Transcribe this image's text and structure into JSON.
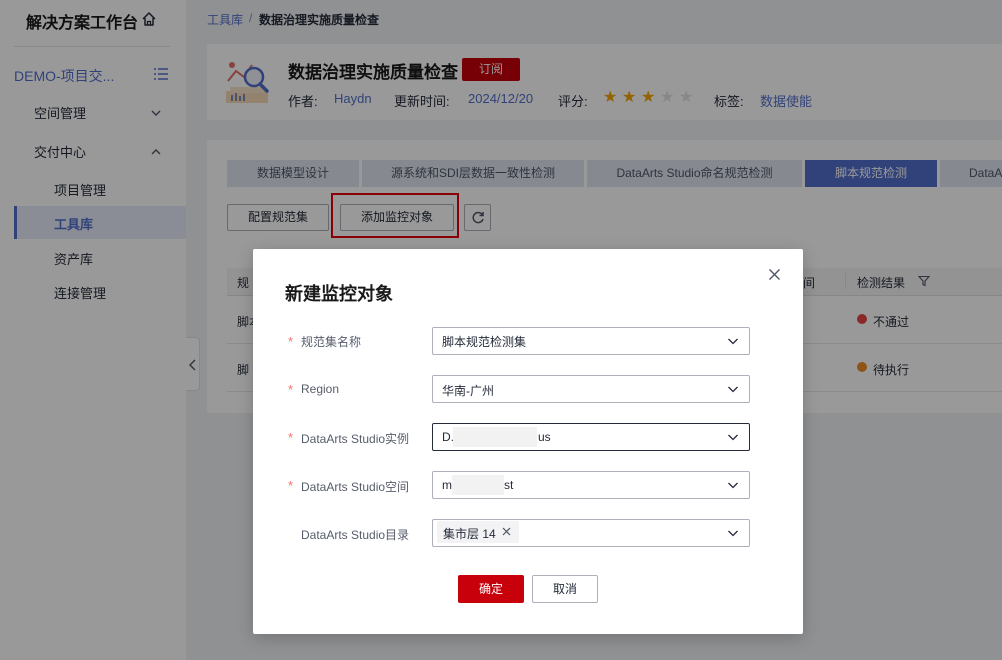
{
  "sidebar": {
    "brand_title": "解决方案工作台",
    "project_title": "DEMO-项目交...",
    "nav": [
      {
        "label": "空间管理"
      },
      {
        "label": "交付中心"
      }
    ],
    "sub_items": [
      {
        "label": "项目管理"
      },
      {
        "label": "工具库"
      },
      {
        "label": "资产库"
      },
      {
        "label": "连接管理"
      }
    ]
  },
  "breadcrumb": {
    "link": "工具库",
    "separator": "/",
    "current": "数据治理实施质量检查"
  },
  "header": {
    "title": "数据治理实施质量检查",
    "subscribe_label": "订阅",
    "author_label": "作者:",
    "author": "Haydn",
    "updated_label": "更新时间:",
    "updated": "2024/12/20",
    "rating_label": "评分:",
    "rating": 3,
    "rating_max": 5,
    "tags_label": "标签:",
    "tag": "数据使能",
    "star_glyph": "★"
  },
  "tabs": [
    {
      "label": "数据模型设计"
    },
    {
      "label": "源系统和SDI层数据一致性检测"
    },
    {
      "label": "DataArts Studio命名规范检测"
    },
    {
      "label": "脚本规范检测"
    },
    {
      "label": "DataA"
    }
  ],
  "toolbar": {
    "config_label": "配置规范集",
    "add_label": "添加监控对象"
  },
  "table": {
    "col_partial": "规",
    "col_time_partial": "间",
    "col_result": "检测结果",
    "rows": [
      {
        "name_partial": "脚本",
        "status": "不通过",
        "status_color": "#e54545"
      },
      {
        "name_partial": "脚",
        "status": "待执行",
        "status_color": "#ec8c24"
      }
    ]
  },
  "modal": {
    "title": "新建监控对象",
    "required_mark": "*",
    "fields": [
      {
        "label": "规范集名称",
        "value": "脚本规范检测集",
        "required": true
      },
      {
        "label": "Region",
        "value": "华南-广州",
        "required": true
      },
      {
        "label": "DataArts Studio实例",
        "value_start": "D.",
        "value_end": "us",
        "required": true
      },
      {
        "label": "DataArts Studio空间",
        "value_start": "m",
        "value_end": "st",
        "required": true
      },
      {
        "label": "DataArts Studio目录",
        "tag": "集市层 14",
        "required": false
      }
    ],
    "ok_label": "确定",
    "cancel_label": "取消"
  },
  "colors": {
    "primary": "#526ecc",
    "danger": "#c7000b",
    "star_on": "#f7a400",
    "star_off": "#dfe1e6"
  }
}
